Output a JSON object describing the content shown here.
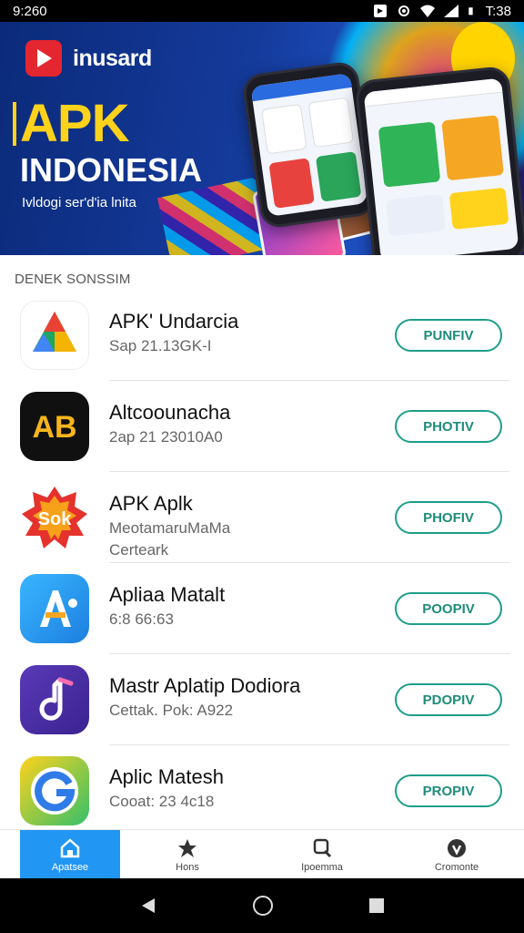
{
  "status_bar": {
    "time": "9:260",
    "right_time": "T:38",
    "icons": [
      "app-icon",
      "settings-icon",
      "wifi-icon",
      "signal-icon",
      "battery-icon"
    ]
  },
  "banner": {
    "brand_name": "inusard",
    "title_line1": "APK",
    "title_line2": "INDONESIA",
    "subtitle": "Ivldogi ser'd'ia lnita"
  },
  "section": {
    "title": "DENEK SONSSIM"
  },
  "apps": [
    {
      "name": "APK' Undarcia",
      "meta": "Sap 21.13GK-I",
      "meta2": "",
      "button": "PUNFIV",
      "icon": "drive-icon"
    },
    {
      "name": "Altcoounacha",
      "meta": "2ap 21 23010A0",
      "meta2": "",
      "button": "PHOTIV",
      "icon": "ab-logo-icon"
    },
    {
      "name": "APK Aplk",
      "meta": "MeotamaruMaMa",
      "meta2": "Certeark",
      "button": "PHOFIV",
      "icon": "sok-logo-icon"
    },
    {
      "name": "Apliaa Matalt",
      "meta": "6:8 66:63",
      "meta2": "",
      "button": "POOPIV",
      "icon": "a-letter-icon"
    },
    {
      "name": "Mastr Aplatip Dodiora",
      "meta": "Cettak. Pok: A922",
      "meta2": "",
      "button": "PDOPIV",
      "icon": "music-note-icon"
    },
    {
      "name": "Aplic Matesh",
      "meta": "Cooat: 23 4c18",
      "meta2": "",
      "button": "PROPIV",
      "icon": "g-logo-icon"
    }
  ],
  "bottom_nav": [
    {
      "label": "Apatsee",
      "icon": "home-icon",
      "active": true
    },
    {
      "label": "Hons",
      "icon": "star-icon",
      "active": false
    },
    {
      "label": "Ipoemma",
      "icon": "search-icon",
      "active": false
    },
    {
      "label": "Cromonte",
      "icon": "profile-icon",
      "active": false
    }
  ],
  "colors": {
    "accent": "#2196f3",
    "button_border": "#1e9e8a",
    "banner_bg": "#143a9a",
    "title_yellow": "#ffd21c"
  }
}
